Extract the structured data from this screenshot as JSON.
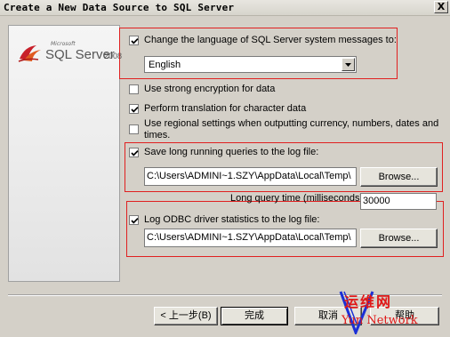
{
  "window": {
    "title": "Create a New Data Source to SQL Server",
    "close_glyph": "X"
  },
  "logo": {
    "microsoft": "Microsoft",
    "product": "SQL Server",
    "version": "2008"
  },
  "options": {
    "change_language": {
      "label": "Change the language of SQL Server system messages to:",
      "checked": true
    },
    "language_select": {
      "value": "English"
    },
    "strong_encryption": {
      "label": "Use strong encryption for data",
      "checked": false
    },
    "translation": {
      "label": "Perform translation for character data",
      "checked": true
    },
    "regional_line1": "Use regional settings when outputting currency, numbers, dates and",
    "regional_line2": "times.",
    "regional_checked": false,
    "long_queries": {
      "label": "Save long running queries to the log file:",
      "checked": true
    },
    "long_queries_path": "C:\\Users\\ADMINI~1.SZY\\AppData\\Local\\Temp\\",
    "long_query_time_label": "Long query time (milliseconds):",
    "long_query_time_value": "30000",
    "odbc_stats": {
      "label": "Log ODBC driver statistics to the log file:",
      "checked": true
    },
    "odbc_stats_path": "C:\\Users\\ADMINI~1.SZY\\AppData\\Local\\Temp\\",
    "browse_label": "Browse..."
  },
  "footer": {
    "back": "< 上一步(B)",
    "finish": "完成",
    "cancel": "取消",
    "help": "帮助"
  },
  "watermark": {
    "cn": "运维网",
    "en": "Yun Network"
  },
  "colors": {
    "highlight_border": "#e02020",
    "watermark_blue": "#1a2fd6",
    "watermark_red": "#e01818"
  }
}
